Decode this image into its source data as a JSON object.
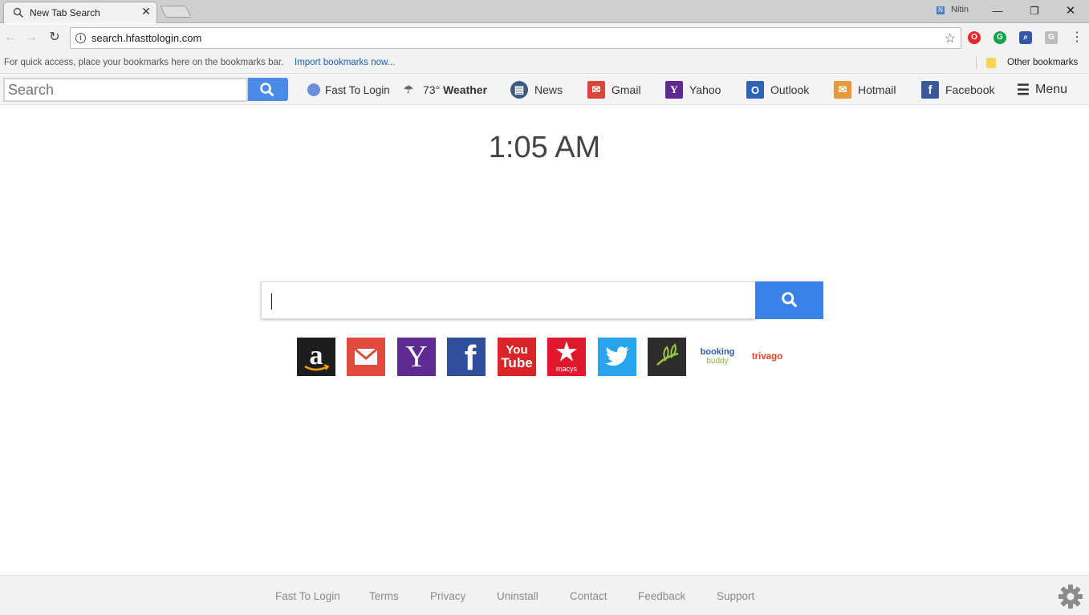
{
  "browser": {
    "tab_title": "New Tab Search",
    "tab_close": "✕",
    "profile_name": "Nitin",
    "url": "search.hfasttologin.com",
    "window_controls": {
      "minimize": "—",
      "restore": "❐",
      "close": "✕"
    }
  },
  "bookmarks_bar": {
    "hint": "For quick access, place your bookmarks here on the bookmarks bar.",
    "import_link": "Import bookmarks now...",
    "other": "Other bookmarks"
  },
  "header": {
    "search_placeholder": "Search",
    "fast_login": "Fast To Login",
    "weather_temp": "73°",
    "weather_label": "Weather",
    "links": {
      "news": "News",
      "gmail": "Gmail",
      "yahoo": "Yahoo",
      "outlook": "Outlook",
      "hotmail": "Hotmail",
      "facebook": "Facebook",
      "menu": "Menu"
    }
  },
  "clock": "1:05 AM",
  "tiles": {
    "youtube_top": "You",
    "youtube_bottom": "Tube",
    "macys": "macys",
    "booking_top": "booking",
    "booking_bottom": "buddy",
    "trivago": "trivago"
  },
  "footer": {
    "links": [
      "Fast To Login",
      "Terms",
      "Privacy",
      "Uninstall",
      "Contact",
      "Feedback",
      "Support"
    ]
  },
  "colors": {
    "accent_blue": "#3b82e8",
    "gmail_red": "#e04a3f",
    "yahoo_purple": "#5f2a91",
    "facebook_blue": "#2f4e9e",
    "youtube_red": "#d9252a",
    "macys_red": "#e0182b",
    "twitter_blue": "#2aa3ef"
  }
}
